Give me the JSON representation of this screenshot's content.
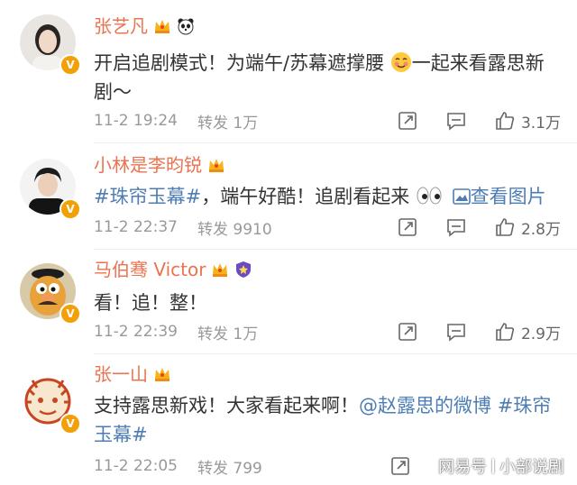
{
  "colors": {
    "name": "#eb7350",
    "link": "#4d7db4",
    "meta": "#999999",
    "verified_badge": "#f2a007"
  },
  "comments": [
    {
      "name": "张艺凡",
      "text_parts": [
        "开启追剧模式！为端午/苏幕遮撑腰",
        "一起来看露思新剧～"
      ],
      "emoji": "blushing-face",
      "time": "11-2 19:24",
      "repost": "转发 1万",
      "likes": "3.1万"
    },
    {
      "name": "小林是李昀锐",
      "hashtag": "#珠帘玉幕#",
      "text": "，端午好酷！追剧看起来",
      "emoji": "eyes",
      "see_picture": "查看图片",
      "time": "11-2 22:37",
      "repost": "转发 9910",
      "likes": "2.8万"
    },
    {
      "name": "马伯骞 Victor",
      "text": "看！追！整！",
      "time": "11-2 22:39",
      "repost": "转发 1万",
      "likes": "2.9万"
    },
    {
      "name": "张一山",
      "text": "支持露思新戏！大家看起来啊！",
      "mention": "@赵露思的微博",
      "hashtag": "#珠帘玉幕#",
      "time": "11-2 22:05",
      "repost": "转发 799"
    }
  ],
  "watermark": {
    "left": "网易号",
    "right": "小部说剧"
  }
}
